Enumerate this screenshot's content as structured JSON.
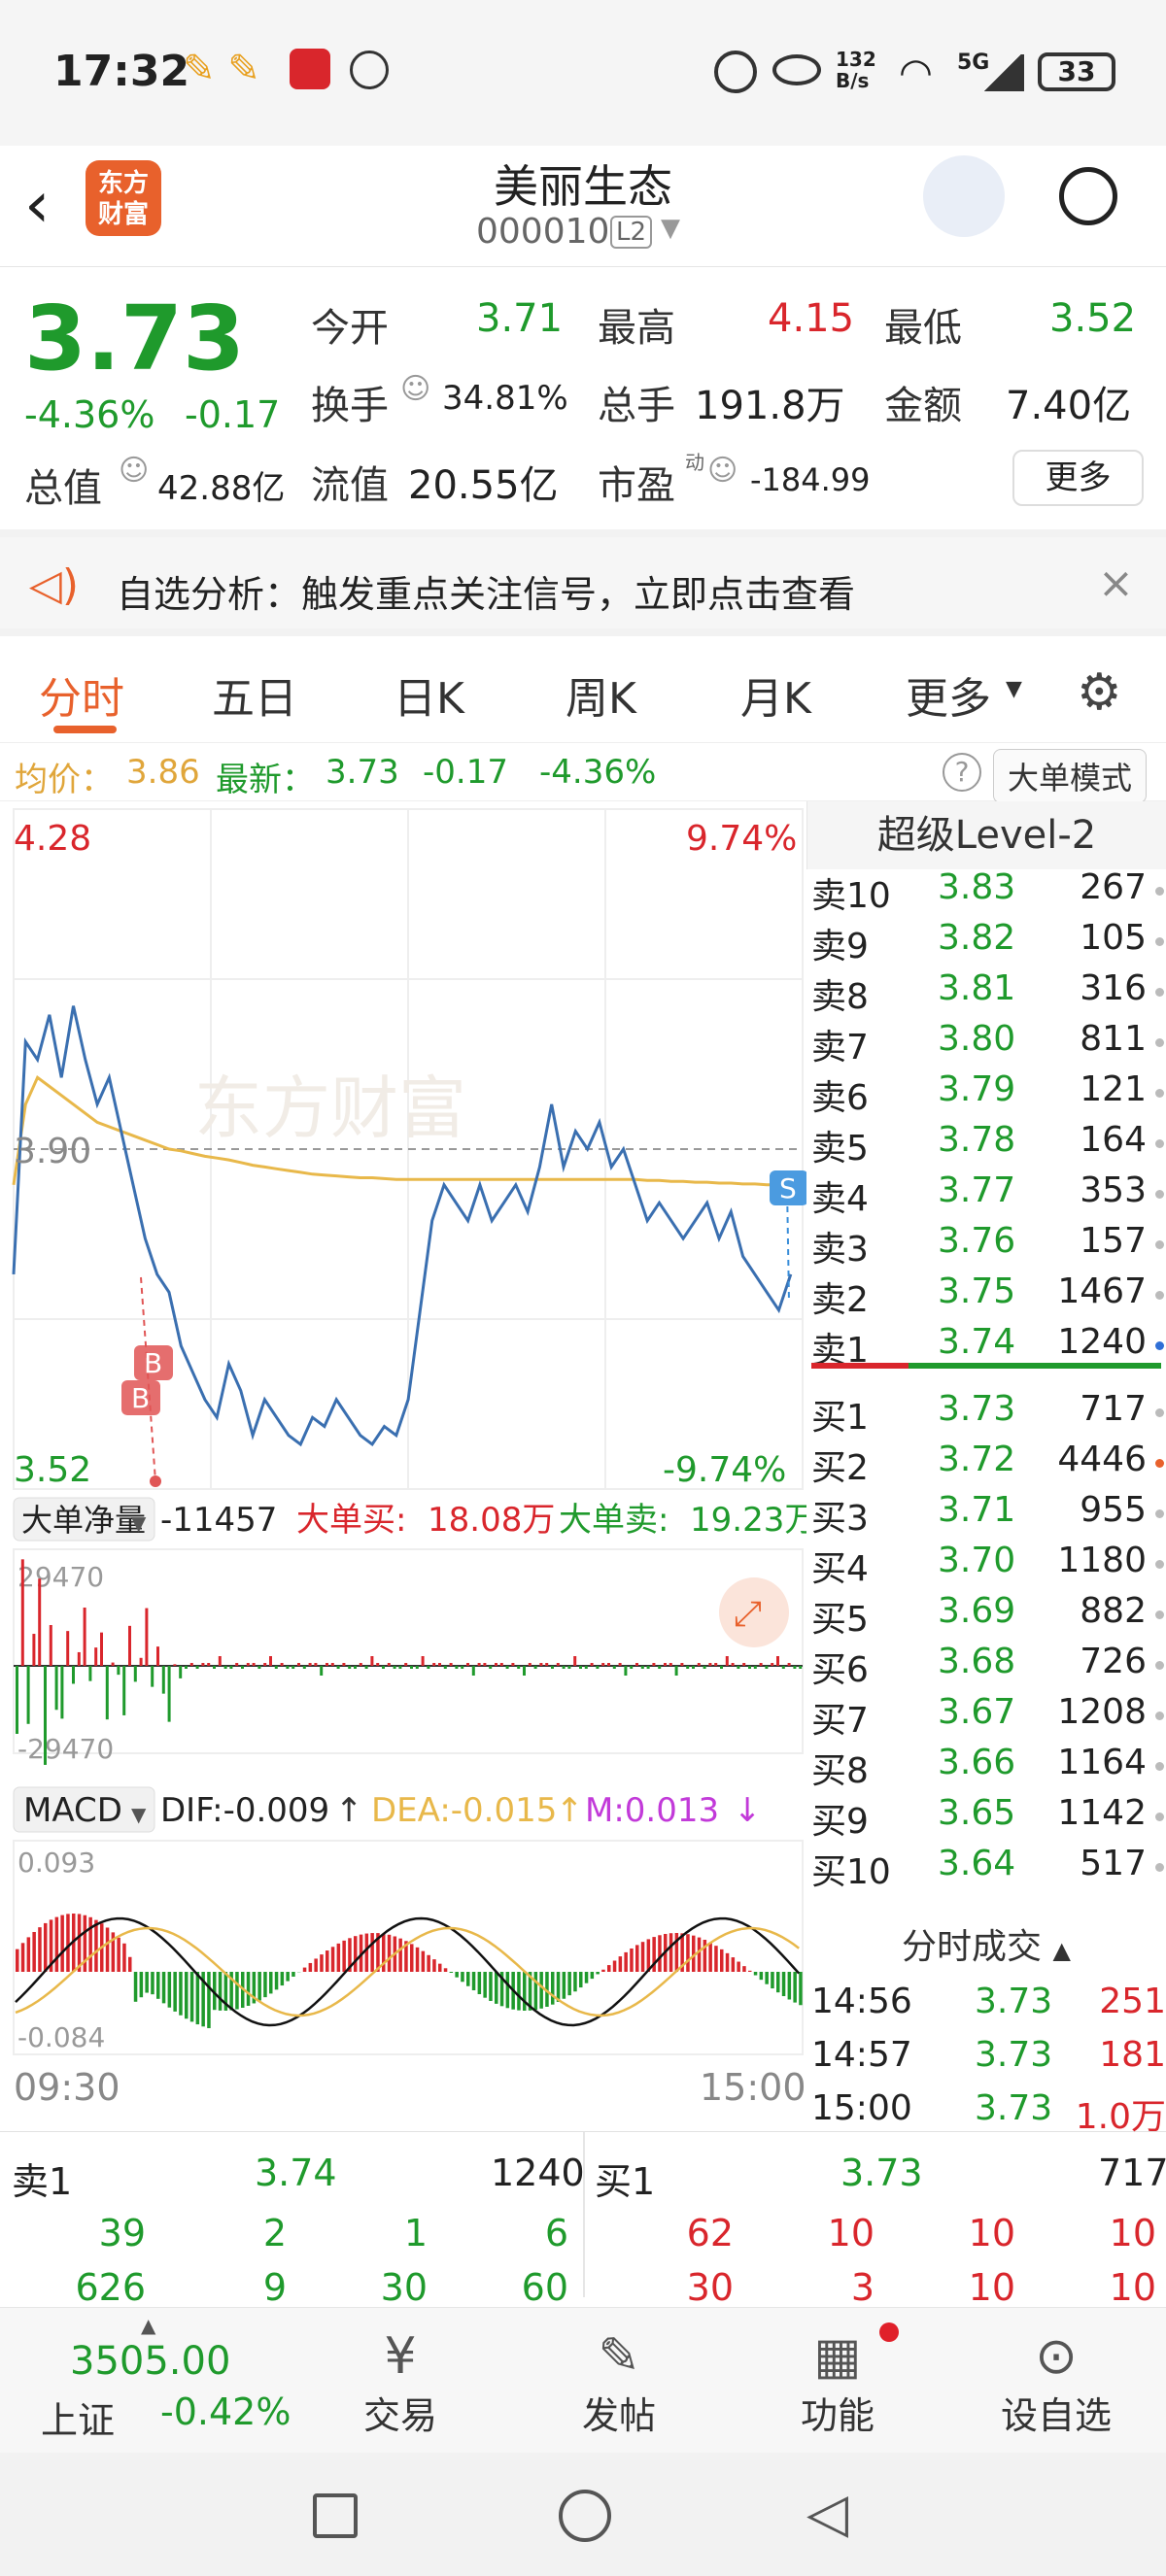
{
  "status": {
    "time": "17:32",
    "net": "132\nB/s",
    "signal": "5G",
    "battery": "33"
  },
  "header": {
    "name": "美丽生态",
    "code": "000010",
    "level": "L2",
    "logo_line1": "东方",
    "logo_line2": "财富"
  },
  "quote": {
    "price": "3.73",
    "pct": "-4.36%",
    "chg": "-0.17",
    "open_label": "今开",
    "open": "3.71",
    "high_label": "最高",
    "high": "4.15",
    "low_label": "最低",
    "low": "3.52",
    "turnover_label": "换手",
    "turnover": "34.81%",
    "vol_label": "总手",
    "vol": "191.8万",
    "amount_label": "金额",
    "amount": "7.40亿",
    "mcap_label": "总值",
    "mcap": "42.88亿",
    "float_label": "流值",
    "float": "20.55亿",
    "pe_label": "市盈",
    "pe_sup": "动",
    "pe": "-184.99",
    "more": "更多"
  },
  "banner": {
    "text": "自选分析：触发重点关注信号，立即点击查看"
  },
  "tabs": [
    "分时",
    "五日",
    "日K",
    "周K",
    "月K",
    "更多"
  ],
  "info": {
    "avg_label": "均价：",
    "avg": "3.86",
    "last_label": "最新：",
    "last": "3.73",
    "chg": "-0.17",
    "pct": "-4.36%",
    "mode": "大单模式"
  },
  "chart": {
    "top_price": "4.28",
    "top_pct": "9.74%",
    "mid_price": "3.90",
    "bot_price": "3.52",
    "bot_pct": "-9.74%",
    "watermark": "东方财富",
    "start_time": "09:30",
    "end_time": "15:00",
    "b1": "B",
    "b2": "B",
    "s1": "S",
    "net_label": "大单净量",
    "net_val": "-11457",
    "buy_label": "大单买:",
    "buy_val": "18.08万",
    "sell_label": "大单卖:",
    "sell_val": "19.23万",
    "vol_top": "29470",
    "vol_bot": "-29470",
    "macd_label": "MACD",
    "dif": "DIF:-0.009",
    "dea": "DEA:-0.015",
    "m": "M:0.013",
    "macd_top": "0.093",
    "macd_bot": "-0.084"
  },
  "chart_data": {
    "type": "line",
    "title": "",
    "xlabel": "",
    "ylabel": "",
    "ylim": [
      3.52,
      4.28
    ],
    "series": [
      {
        "name": "",
        "values": [
          3.76,
          4.02,
          4.0,
          4.05,
          3.98,
          4.06,
          4.0,
          3.95,
          3.98,
          3.92,
          3.86,
          3.8,
          3.76,
          3.74,
          3.68,
          3.65,
          3.62,
          3.6,
          3.66,
          3.63,
          3.58,
          3.62,
          3.6,
          3.58,
          3.57,
          3.6,
          3.59,
          3.62,
          3.6,
          3.58,
          3.57,
          3.59,
          3.58,
          3.62,
          3.72,
          3.82,
          3.86,
          3.84,
          3.82,
          3.86,
          3.82,
          3.84,
          3.86,
          3.83,
          3.88,
          3.95,
          3.88,
          3.92,
          3.9,
          3.93,
          3.88,
          3.9,
          3.86,
          3.82,
          3.84,
          3.82,
          3.8,
          3.82,
          3.84,
          3.8,
          3.83,
          3.78,
          3.76,
          3.74,
          3.72,
          3.76
        ]
      },
      {
        "name": "",
        "values": [
          3.86,
          3.95,
          3.98,
          3.97,
          3.96,
          3.95,
          3.94,
          3.93,
          3.925,
          3.92,
          3.915,
          3.91,
          3.905,
          3.9,
          3.898,
          3.895,
          3.892,
          3.89,
          3.888,
          3.885,
          3.882,
          3.88,
          3.878,
          3.876,
          3.874,
          3.872,
          3.871,
          3.87,
          3.869,
          3.868,
          3.868,
          3.867,
          3.866,
          3.866,
          3.866,
          3.866,
          3.866,
          3.866,
          3.866,
          3.866,
          3.866,
          3.866,
          3.866,
          3.866,
          3.866,
          3.866,
          3.866,
          3.866,
          3.866,
          3.866,
          3.866,
          3.866,
          3.866,
          3.865,
          3.865,
          3.864,
          3.864,
          3.863,
          3.863,
          3.862,
          3.862,
          3.861,
          3.861,
          3.86,
          3.86,
          3.86
        ]
      }
    ]
  },
  "orderbook": {
    "title": "超级Level-2",
    "asks": [
      [
        "卖10",
        "3.83",
        "267"
      ],
      [
        "卖9",
        "3.82",
        "105"
      ],
      [
        "卖8",
        "3.81",
        "316"
      ],
      [
        "卖7",
        "3.80",
        "811"
      ],
      [
        "卖6",
        "3.79",
        "121"
      ],
      [
        "卖5",
        "3.78",
        "164"
      ],
      [
        "卖4",
        "3.77",
        "353"
      ],
      [
        "卖3",
        "3.76",
        "157"
      ],
      [
        "卖2",
        "3.75",
        "1467"
      ],
      [
        "卖1",
        "3.74",
        "1240"
      ]
    ],
    "bids": [
      [
        "买1",
        "3.73",
        "717"
      ],
      [
        "买2",
        "3.72",
        "4446"
      ],
      [
        "买3",
        "3.71",
        "955"
      ],
      [
        "买4",
        "3.70",
        "1180"
      ],
      [
        "买5",
        "3.69",
        "882"
      ],
      [
        "买6",
        "3.68",
        "726"
      ],
      [
        "买7",
        "3.67",
        "1208"
      ],
      [
        "买8",
        "3.66",
        "1164"
      ],
      [
        "买9",
        "3.65",
        "1142"
      ],
      [
        "买10",
        "3.64",
        "517"
      ]
    ],
    "trades_title": "分时成交",
    "trades": [
      [
        "14:56",
        "3.73",
        "251"
      ],
      [
        "14:57",
        "3.73",
        "181"
      ],
      [
        "15:00",
        "3.73",
        "1.0万"
      ]
    ]
  },
  "bottom": {
    "sell_label": "卖1",
    "sell_price": "3.74",
    "sell_vol": "1240",
    "buy_label": "买1",
    "buy_price": "3.73",
    "buy_vol": "717",
    "sell_row1": [
      "39",
      "2",
      "1",
      "6"
    ],
    "buy_row1": [
      "62",
      "10",
      "10",
      "10"
    ],
    "sell_row2": [
      "626",
      "9",
      "30",
      "60"
    ],
    "buy_row2": [
      "30",
      "3",
      "10",
      "10"
    ]
  },
  "nav": {
    "index_price": "3505.00",
    "index_name": "上证",
    "index_pct": "-0.42%",
    "items": [
      "交易",
      "发帖",
      "功能",
      "设自选"
    ]
  },
  "colors": {
    "accent": "#e8612c",
    "up": "#d9262c",
    "down": "#1f9a2c",
    "price_line": "#3a6fb0",
    "avg_line": "#e8b84a"
  }
}
